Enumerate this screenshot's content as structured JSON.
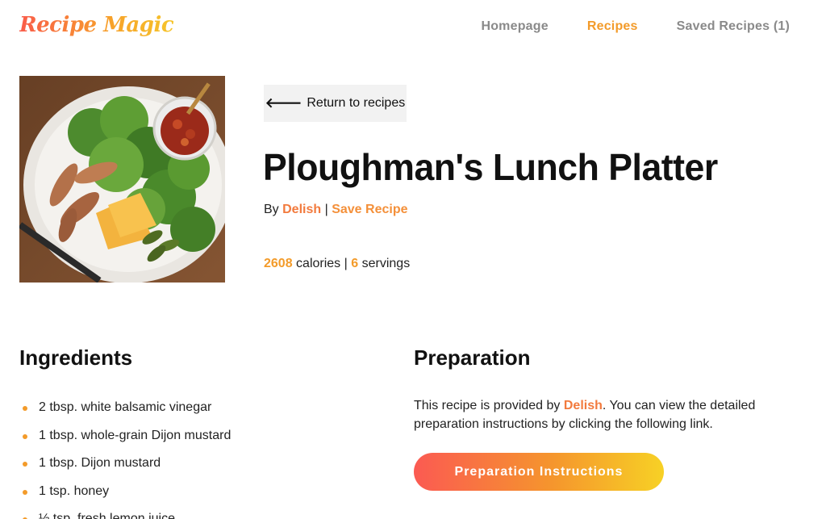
{
  "header": {
    "logo": "Recipe Magic",
    "nav": [
      {
        "label": "Homepage"
      },
      {
        "label": "Recipes"
      },
      {
        "label": "Saved Recipes (1)"
      }
    ]
  },
  "recipe": {
    "back_label": "Return to recipes",
    "title": "Ploughman's Lunch Platter",
    "by_label": "By",
    "source": "Delish",
    "separator": "|",
    "save_label": "Save Recipe",
    "calories": "2608",
    "calories_label": "calories",
    "servings": "6",
    "servings_label": "servings",
    "image_alt": "Ploughman's Lunch Platter"
  },
  "ingredients": {
    "heading": "Ingredients",
    "items": [
      "2 tbsp. white balsamic vinegar",
      "1 tbsp. whole-grain Dijon mustard",
      "1 tbsp. Dijon mustard",
      "1 tsp. honey",
      "½ tsp. fresh lemon juice"
    ]
  },
  "preparation": {
    "heading": "Preparation",
    "text_before": "This recipe is provided by ",
    "source": "Delish",
    "text_after": ". You can view the detailed preparation instructions by clicking the following link.",
    "button_label": "Preparation Instructions"
  },
  "colors": {
    "accent": "#f39b2a",
    "accent_red": "#fb5a52",
    "accent_yellow": "#f7d125"
  }
}
